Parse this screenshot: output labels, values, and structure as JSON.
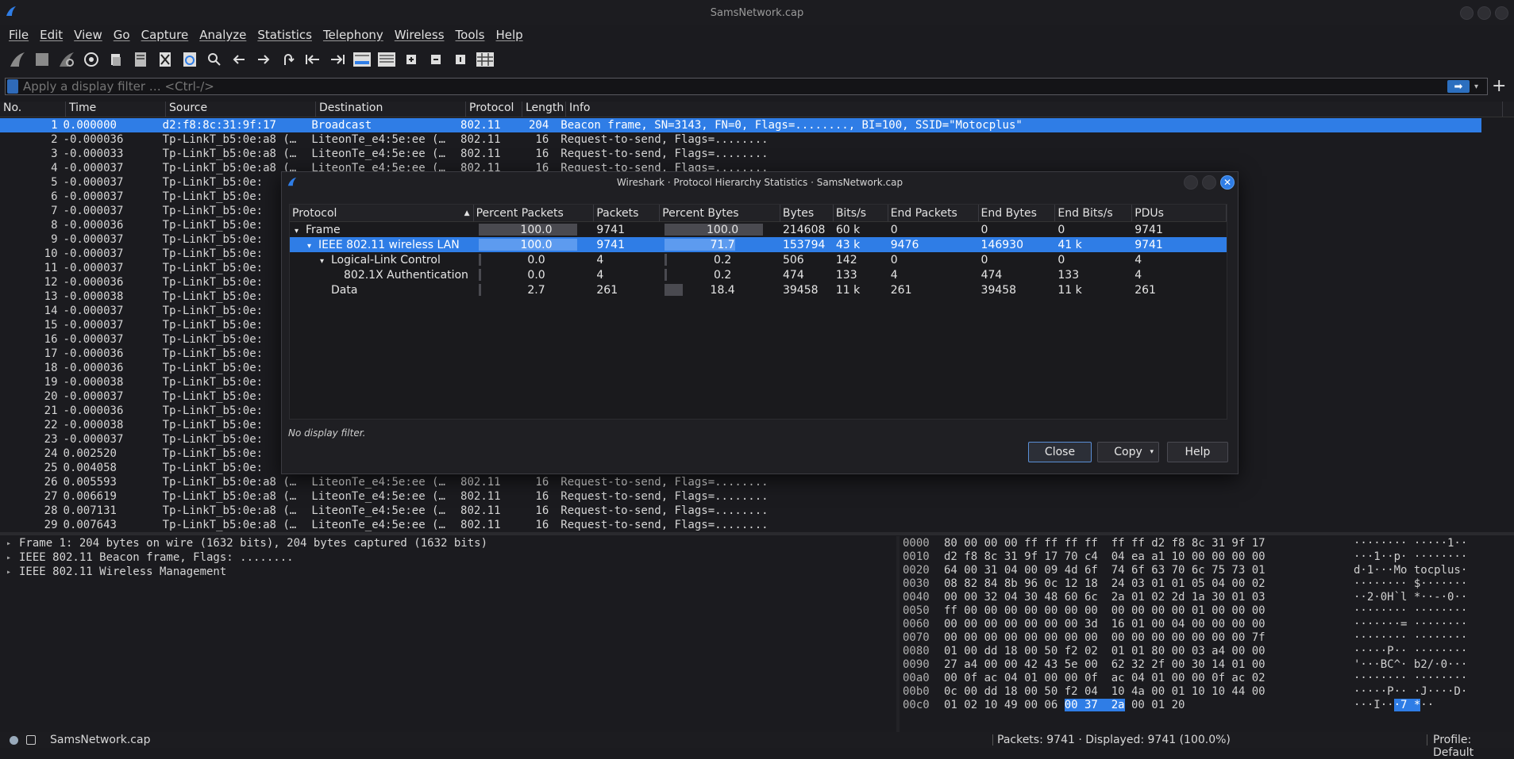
{
  "window": {
    "title": "SamsNetwork.cap"
  },
  "menu": [
    "File",
    "Edit",
    "View",
    "Go",
    "Capture",
    "Analyze",
    "Statistics",
    "Telephony",
    "Wireless",
    "Tools",
    "Help"
  ],
  "filter": {
    "placeholder": "Apply a display filter … <Ctrl-/>"
  },
  "packet_list": {
    "columns": [
      "No.",
      "Time",
      "Source",
      "Destination",
      "Protocol",
      "Length",
      "Info"
    ],
    "rows": [
      [
        "1",
        "0.000000",
        "d2:f8:8c:31:9f:17",
        "Broadcast",
        "802.11",
        "204",
        "Beacon frame, SN=3143, FN=0, Flags=........, BI=100, SSID=\"Motocplus\""
      ],
      [
        "2",
        "-0.000036",
        "Tp-LinkT_b5:0e:a8 (…",
        "LiteonTe_e4:5e:ee (…",
        "802.11",
        "16",
        "Request-to-send, Flags=........"
      ],
      [
        "3",
        "-0.000033",
        "Tp-LinkT_b5:0e:a8 (…",
        "LiteonTe_e4:5e:ee (…",
        "802.11",
        "16",
        "Request-to-send, Flags=........"
      ],
      [
        "4",
        "-0.000037",
        "Tp-LinkT_b5:0e:a8 (…",
        "LiteonTe_e4:5e:ee (…",
        "802.11",
        "16",
        "Request-to-send, Flags=........"
      ],
      [
        "5",
        "-0.000037",
        "Tp-LinkT_b5:0e:",
        "",
        "",
        "",
        ""
      ],
      [
        "6",
        "-0.000037",
        "Tp-LinkT_b5:0e:",
        "",
        "",
        "",
        ""
      ],
      [
        "7",
        "-0.000037",
        "Tp-LinkT_b5:0e:",
        "",
        "",
        "",
        ""
      ],
      [
        "8",
        "-0.000036",
        "Tp-LinkT_b5:0e:",
        "",
        "",
        "",
        ""
      ],
      [
        "9",
        "-0.000037",
        "Tp-LinkT_b5:0e:",
        "",
        "",
        "",
        ""
      ],
      [
        "10",
        "-0.000037",
        "Tp-LinkT_b5:0e:",
        "",
        "",
        "",
        ""
      ],
      [
        "11",
        "-0.000037",
        "Tp-LinkT_b5:0e:",
        "",
        "",
        "",
        ""
      ],
      [
        "12",
        "-0.000036",
        "Tp-LinkT_b5:0e:",
        "",
        "",
        "",
        ""
      ],
      [
        "13",
        "-0.000038",
        "Tp-LinkT_b5:0e:",
        "",
        "",
        "",
        ""
      ],
      [
        "14",
        "-0.000037",
        "Tp-LinkT_b5:0e:",
        "",
        "",
        "",
        ""
      ],
      [
        "15",
        "-0.000037",
        "Tp-LinkT_b5:0e:",
        "",
        "",
        "",
        ""
      ],
      [
        "16",
        "-0.000037",
        "Tp-LinkT_b5:0e:",
        "",
        "",
        "",
        ""
      ],
      [
        "17",
        "-0.000036",
        "Tp-LinkT_b5:0e:",
        "",
        "",
        "",
        ""
      ],
      [
        "18",
        "-0.000036",
        "Tp-LinkT_b5:0e:",
        "",
        "",
        "",
        ""
      ],
      [
        "19",
        "-0.000038",
        "Tp-LinkT_b5:0e:",
        "",
        "",
        "",
        ""
      ],
      [
        "20",
        "-0.000037",
        "Tp-LinkT_b5:0e:",
        "",
        "",
        "",
        ""
      ],
      [
        "21",
        "-0.000036",
        "Tp-LinkT_b5:0e:",
        "",
        "",
        "",
        ""
      ],
      [
        "22",
        "-0.000038",
        "Tp-LinkT_b5:0e:",
        "",
        "",
        "",
        ""
      ],
      [
        "23",
        "-0.000037",
        "Tp-LinkT_b5:0e:",
        "",
        "",
        "",
        ""
      ],
      [
        "24",
        "0.002520",
        "Tp-LinkT_b5:0e:",
        "",
        "",
        "",
        ""
      ],
      [
        "25",
        "0.004058",
        "Tp-LinkT_b5:0e:",
        "",
        "",
        "",
        ""
      ],
      [
        "26",
        "0.005593",
        "Tp-LinkT_b5:0e:a8 (…",
        "LiteonTe_e4:5e:ee (…",
        "802.11",
        "16",
        "Request-to-send, Flags=........"
      ],
      [
        "27",
        "0.006619",
        "Tp-LinkT_b5:0e:a8 (…",
        "LiteonTe_e4:5e:ee (…",
        "802.11",
        "16",
        "Request-to-send, Flags=........"
      ],
      [
        "28",
        "0.007131",
        "Tp-LinkT_b5:0e:a8 (…",
        "LiteonTe_e4:5e:ee (…",
        "802.11",
        "16",
        "Request-to-send, Flags=........"
      ],
      [
        "29",
        "0.007643",
        "Tp-LinkT_b5:0e:a8 (…",
        "LiteonTe_e4:5e:ee (…",
        "802.11",
        "16",
        "Request-to-send, Flags=........"
      ]
    ],
    "selected_row": 0
  },
  "details": [
    "Frame 1: 204 bytes on wire (1632 bits), 204 bytes captured (1632 bits)",
    "IEEE 802.11 Beacon frame, Flags: ........",
    "IEEE 802.11 Wireless Management"
  ],
  "hex": [
    {
      "off": "0000",
      "bytes": "80 00 00 00 ff ff ff ff  ff ff d2 f8 8c 31 9f 17",
      "ascii": "········ ·····1··"
    },
    {
      "off": "0010",
      "bytes": "d2 f8 8c 31 9f 17 70 c4  04 ea a1 10 00 00 00 00",
      "ascii": "···1··p· ········"
    },
    {
      "off": "0020",
      "bytes": "64 00 31 04 00 09 4d 6f  74 6f 63 70 6c 75 73 01",
      "ascii": "d·1···Mo tocplus·"
    },
    {
      "off": "0030",
      "bytes": "08 82 84 8b 96 0c 12 18  24 03 01 01 05 04 00 02",
      "ascii": "········ $·······"
    },
    {
      "off": "0040",
      "bytes": "00 00 32 04 30 48 60 6c  2a 01 02 2d 1a 30 01 03",
      "ascii": "··2·0H`l *··-·0··"
    },
    {
      "off": "0050",
      "bytes": "ff 00 00 00 00 00 00 00  00 00 00 00 01 00 00 00",
      "ascii": "········ ········"
    },
    {
      "off": "0060",
      "bytes": "00 00 00 00 00 00 00 3d  16 01 00 04 00 00 00 00",
      "ascii": "·······= ········"
    },
    {
      "off": "0070",
      "bytes": "00 00 00 00 00 00 00 00  00 00 00 00 00 00 00 7f",
      "ascii": "········ ········"
    },
    {
      "off": "0080",
      "bytes": "01 00 dd 18 00 50 f2 02  01 01 80 00 03 a4 00 00",
      "ascii": "·····P·· ········"
    },
    {
      "off": "0090",
      "bytes": "27 a4 00 00 42 43 5e 00  62 32 2f 00 30 14 01 00",
      "ascii": "'···BC^· b2/·0···"
    },
    {
      "off": "00a0",
      "bytes": "00 0f ac 04 01 00 00 0f  ac 04 01 00 00 0f ac 02",
      "ascii": "········ ········"
    },
    {
      "off": "00b0",
      "bytes": "0c 00 dd 18 00 50 f2 04  10 4a 00 01 10 10 44 00",
      "ascii": "·····P·· ·J····D·"
    },
    {
      "off": "00c0",
      "bytes": "01 02 10 49 00 06 ",
      "hl": "00 37  2a",
      "rest": " 00 01 20",
      "ascii": "···I··",
      "ascii_hl": "·7 *",
      "ascii_rest": "··"
    }
  ],
  "status": {
    "file": "SamsNetwork.cap",
    "packets": "Packets: 9741 · Displayed: 9741 (100.0%)",
    "profile": "Profile: Default"
  },
  "dialog": {
    "title": "Wireshark · Protocol Hierarchy Statistics · SamsNetwork.cap",
    "columns": [
      "Protocol",
      "Percent Packets",
      "Packets",
      "Percent Bytes",
      "Bytes",
      "Bits/s",
      "End Packets",
      "End Bytes",
      "End Bits/s",
      "PDUs"
    ],
    "rows": [
      {
        "level": 0,
        "arrow": "▾",
        "protocol": "Frame",
        "pct_packets": "100.0",
        "pct_packets_val": 100,
        "packets": "9741",
        "pct_bytes": "100.0",
        "pct_bytes_val": 100,
        "bytes": "214608",
        "bits": "60 k",
        "end_packets": "0",
        "end_bytes": "0",
        "end_bits": "0",
        "pdus": "9741"
      },
      {
        "level": 1,
        "arrow": "▾",
        "protocol": "IEEE 802.11 wireless LAN",
        "pct_packets": "100.0",
        "pct_packets_val": 100,
        "packets": "9741",
        "pct_bytes": "71.7",
        "pct_bytes_val": 71.7,
        "bytes": "153794",
        "bits": "43 k",
        "end_packets": "9476",
        "end_bytes": "146930",
        "end_bits": "41 k",
        "pdus": "9741"
      },
      {
        "level": 2,
        "arrow": "▾",
        "protocol": "Logical-Link Control",
        "pct_packets": "0.0",
        "pct_packets_val": 0,
        "packets": "4",
        "pct_bytes": "0.2",
        "pct_bytes_val": 0.2,
        "bytes": "506",
        "bits": "142",
        "end_packets": "0",
        "end_bytes": "0",
        "end_bits": "0",
        "pdus": "4"
      },
      {
        "level": 3,
        "arrow": "",
        "protocol": "802.1X Authentication",
        "pct_packets": "0.0",
        "pct_packets_val": 0,
        "packets": "4",
        "pct_bytes": "0.2",
        "pct_bytes_val": 0.2,
        "bytes": "474",
        "bits": "133",
        "end_packets": "4",
        "end_bytes": "474",
        "end_bits": "133",
        "pdus": "4"
      },
      {
        "level": 2,
        "arrow": "",
        "protocol": "Data",
        "pct_packets": "2.7",
        "pct_packets_val": 2.7,
        "packets": "261",
        "pct_bytes": "18.4",
        "pct_bytes_val": 18.4,
        "bytes": "39458",
        "bits": "11 k",
        "end_packets": "261",
        "end_bytes": "39458",
        "end_bits": "11 k",
        "pdus": "261"
      }
    ],
    "selected_row": 1,
    "no_filter": "No display filter.",
    "buttons": {
      "close": "Close",
      "copy": "Copy",
      "help": "Help"
    }
  }
}
